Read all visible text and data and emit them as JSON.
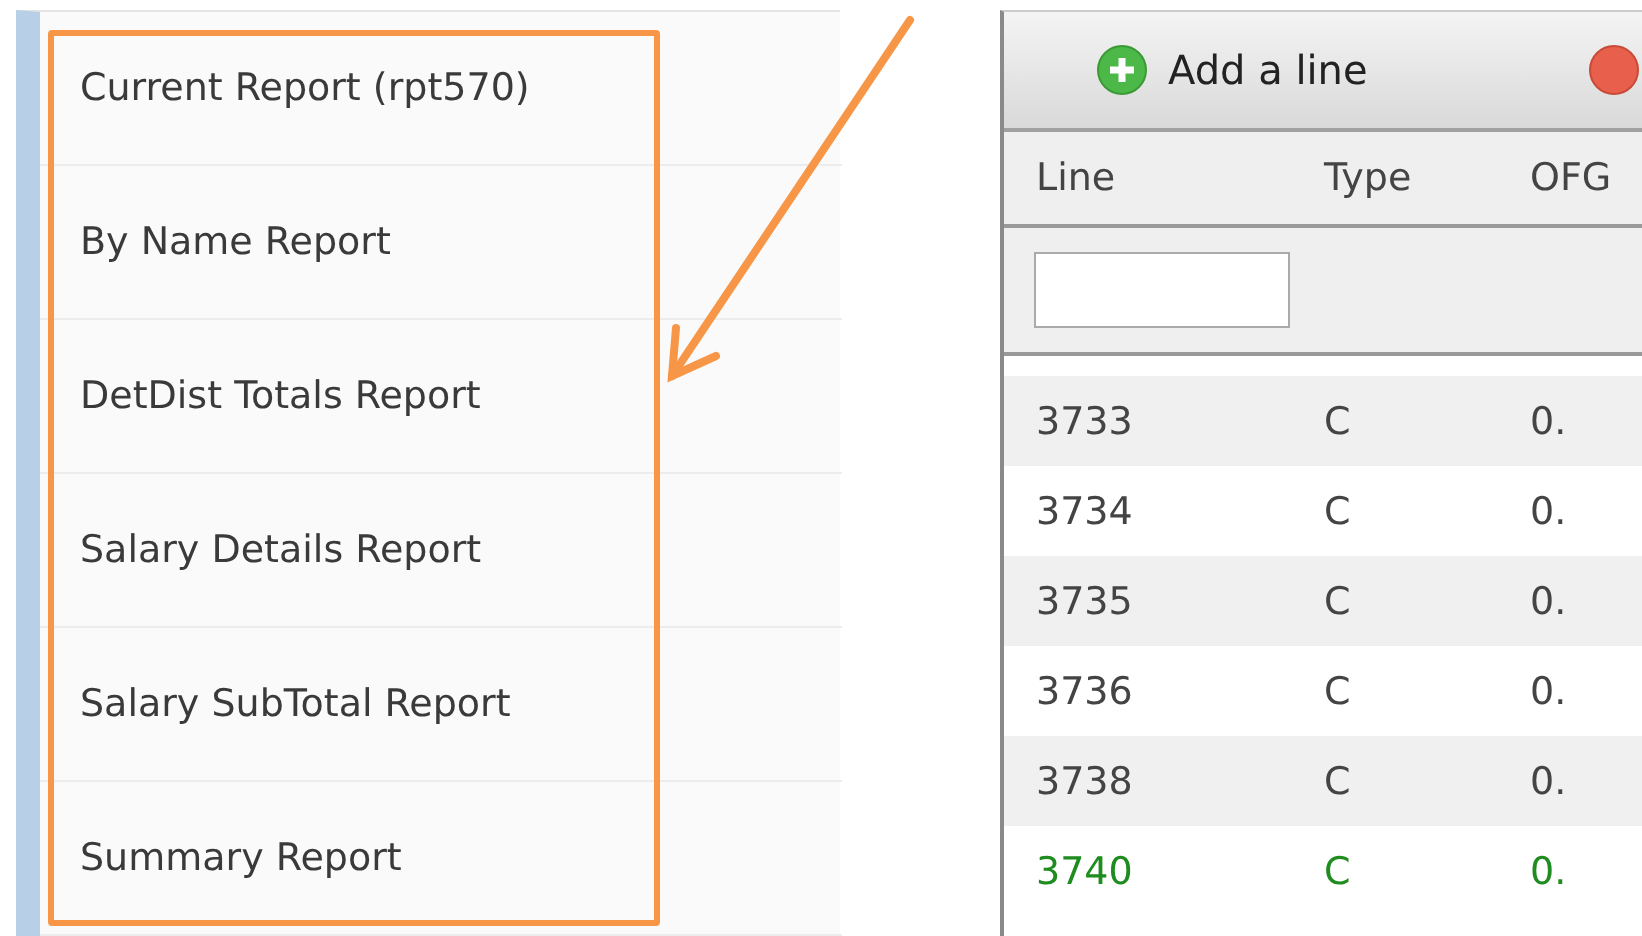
{
  "report_menu": {
    "items": [
      {
        "label": "Current Report (rpt570)"
      },
      {
        "label": "By Name Report"
      },
      {
        "label": "DetDist Totals Report"
      },
      {
        "label": "Salary Details Report"
      },
      {
        "label": "Salary SubTotal Report"
      },
      {
        "label": "Summary Report"
      }
    ]
  },
  "toolbar": {
    "buttons": [
      {
        "label": "Add a line",
        "kind": "add"
      },
      {
        "kind": "remove"
      }
    ]
  },
  "table": {
    "columns": [
      "Line",
      "Type",
      "OFG"
    ],
    "rows": [
      {
        "cells": [
          "3733",
          "C",
          "0."
        ],
        "color": "#444444"
      },
      {
        "cells": [
          "3734",
          "C",
          "0."
        ],
        "color": "#444444"
      },
      {
        "cells": [
          "3735",
          "C",
          "0."
        ],
        "color": "#444444"
      },
      {
        "cells": [
          "3736",
          "C",
          "0."
        ],
        "color": "#444444"
      },
      {
        "cells": [
          "3738",
          "C",
          "0."
        ],
        "color": "#444444"
      },
      {
        "cells": [
          "3740",
          "C",
          "0."
        ],
        "color": "#1e8c1e"
      }
    ]
  }
}
